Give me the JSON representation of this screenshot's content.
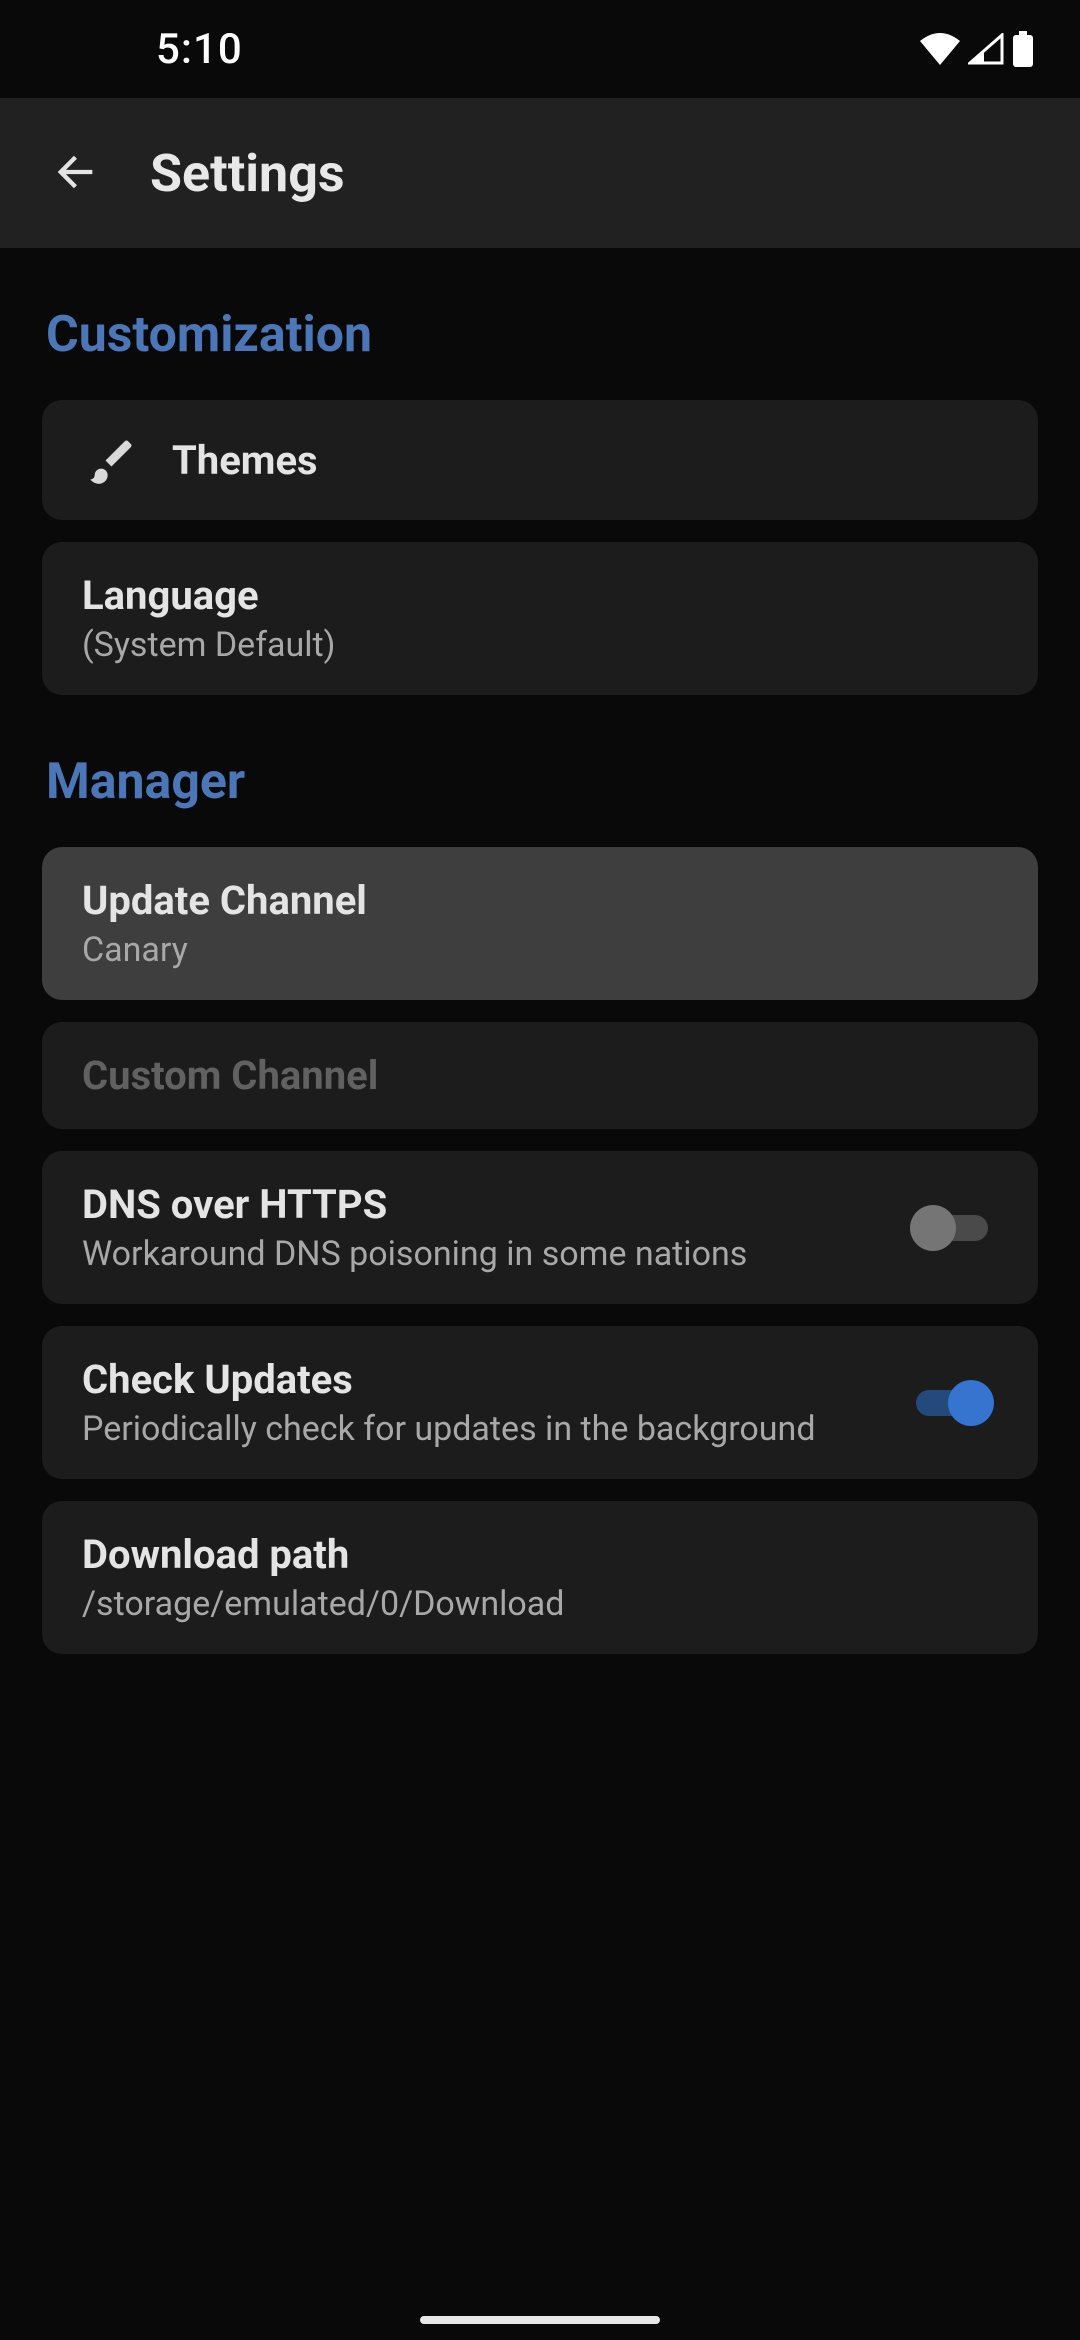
{
  "status": {
    "time": "5:10"
  },
  "appbar": {
    "title": "Settings"
  },
  "sections": {
    "customization": {
      "header": "Customization",
      "themes": {
        "label": "Themes"
      },
      "language": {
        "label": "Language",
        "value": "(System Default)"
      }
    },
    "manager": {
      "header": "Manager",
      "update_channel": {
        "label": "Update Channel",
        "value": "Canary"
      },
      "custom_channel": {
        "label": "Custom Channel"
      },
      "doh": {
        "label": "DNS over HTTPS",
        "desc": "Workaround DNS poisoning in some nations",
        "enabled": false
      },
      "check_updates": {
        "label": "Check Updates",
        "desc": "Periodically check for updates in the background",
        "enabled": true
      },
      "download_path": {
        "label": "Download path",
        "value": "/storage/emulated/0/Download"
      }
    }
  }
}
